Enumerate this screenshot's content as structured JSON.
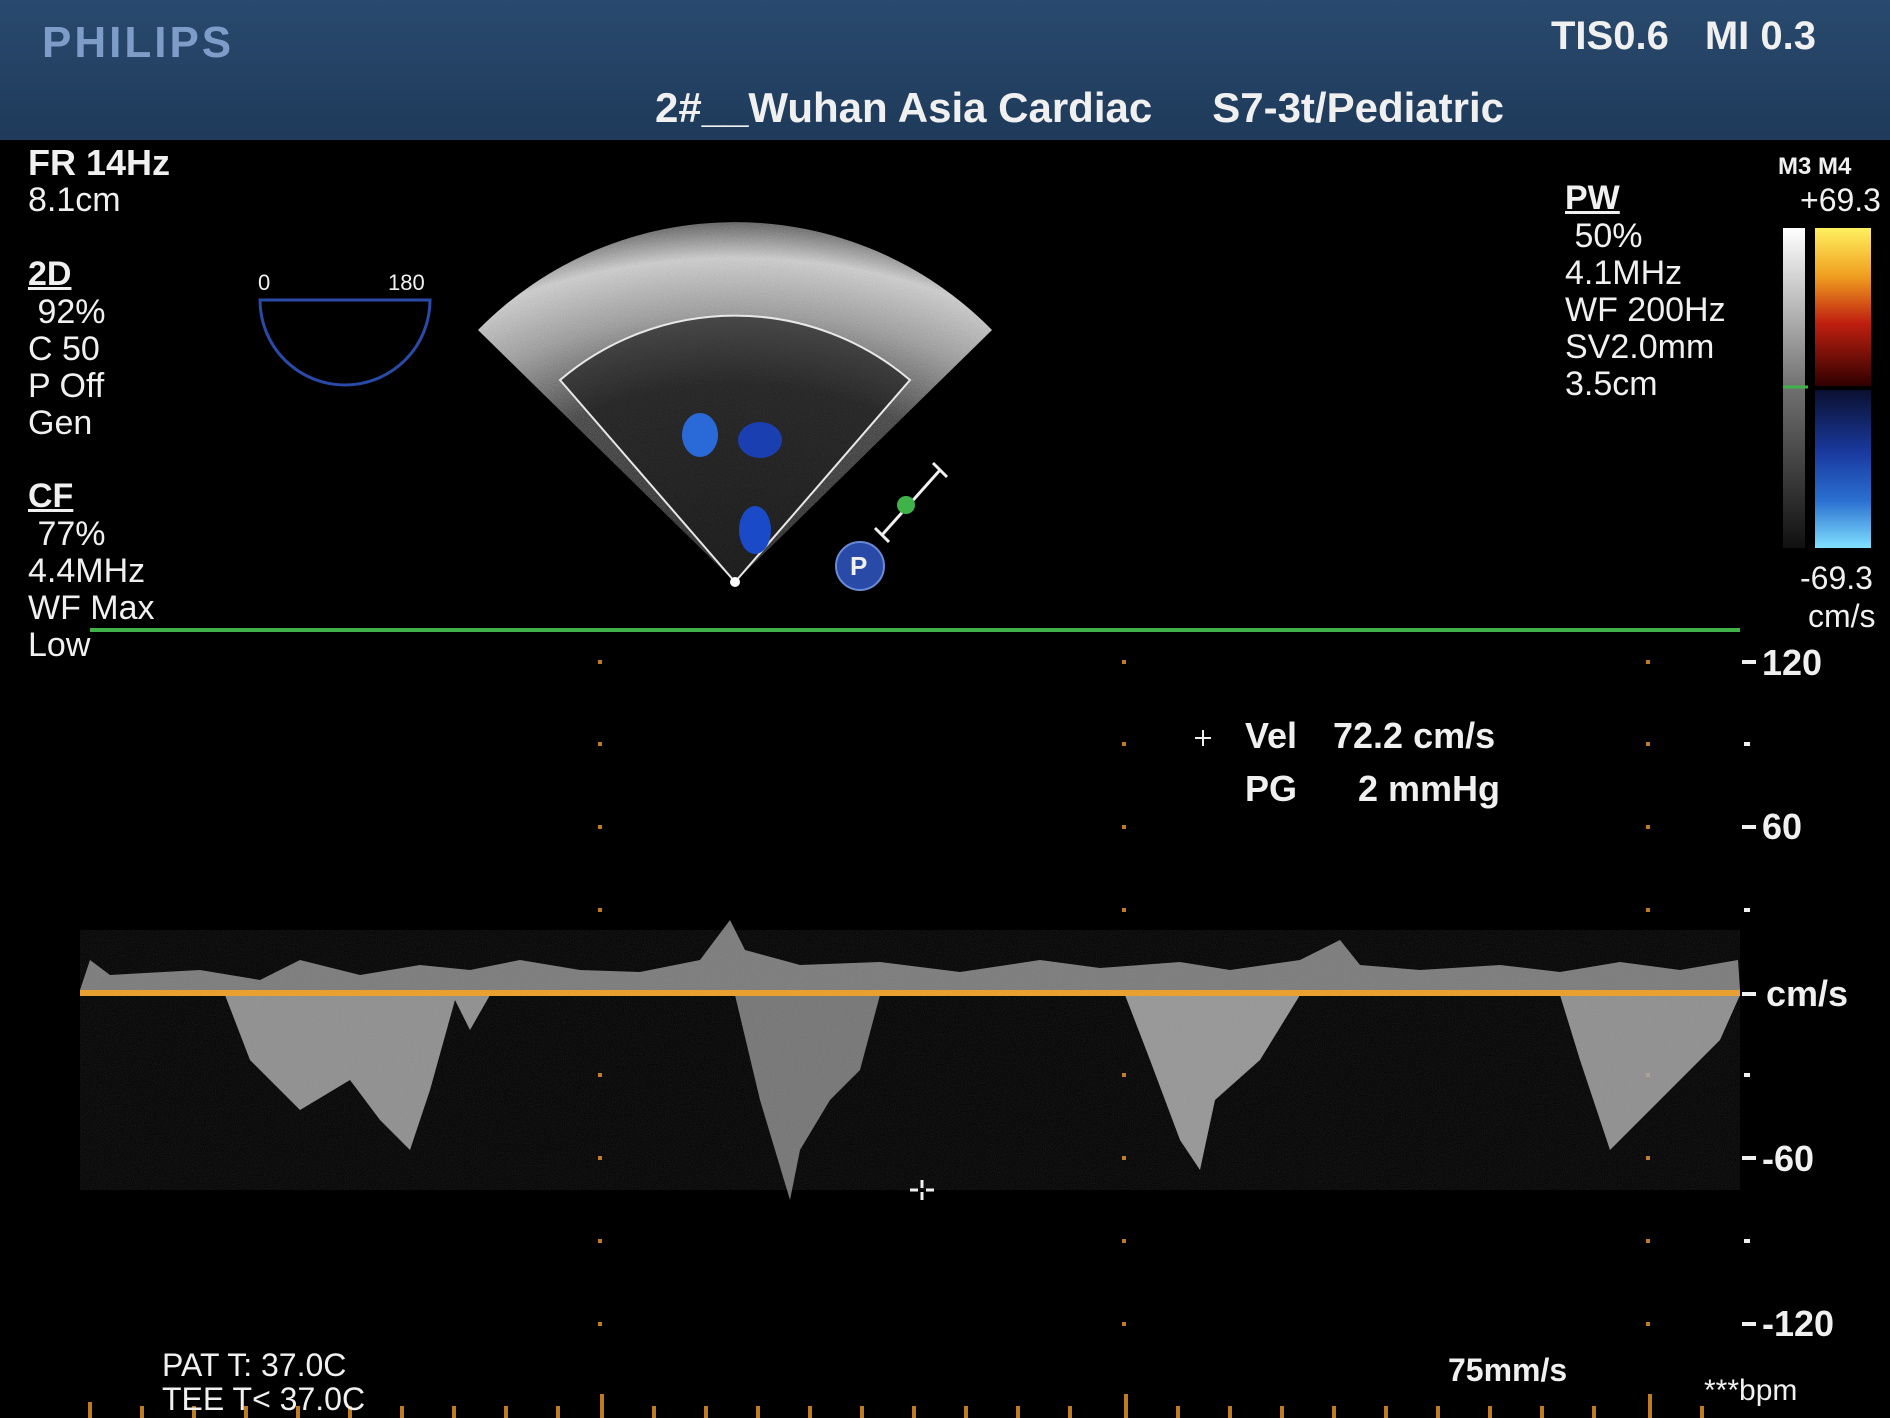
{
  "header": {
    "brand": "PHILIPS",
    "tis": "TIS0.6",
    "mi": "MI 0.3",
    "site": "2#__Wuhan Asia Cardiac",
    "probe": "S7-3t/Pediatric"
  },
  "left_params": {
    "fr": "FR 14Hz",
    "depth": "8.1cm",
    "mode_2d": "2D",
    "gain_2d": " 92%",
    "c": "C 50",
    "p": "P Off",
    "gen": "Gen",
    "mode_cf": "CF",
    "gain_cf": " 77%",
    "freq_cf": "4.4MHz",
    "wf_cf": "WF Max",
    "low": "Low"
  },
  "angle": {
    "min": "0",
    "max": "180"
  },
  "pw_params": {
    "mode": "PW",
    "gain": " 50%",
    "freq": "4.1MHz",
    "wf": "WF 200Hz",
    "sv": "SV2.0mm",
    "depth": "3.5cm"
  },
  "color_bar": {
    "maps": "M3 M4",
    "top": "+69.3",
    "bottom": "-69.3",
    "unit": "cm/s"
  },
  "measurement": {
    "vel_label": "Vel",
    "vel_value": "72.2 cm/s",
    "pg_label": "PG",
    "pg_value": "2 mmHg"
  },
  "scale": {
    "t120": "120",
    "t60": "60",
    "unit": "cm/s",
    "tm60": "-60",
    "tm120": "-120"
  },
  "footer": {
    "pat_t": "PAT T: 37.0C",
    "tee_t": "TEE T< 37.0C",
    "sweep": "75mm/s",
    "bpm": "***bpm"
  },
  "probe_marker": "P",
  "colors": {
    "baseline": "#e8a030",
    "gate_line": "#3fb34a",
    "header_bg": "#23406a"
  }
}
